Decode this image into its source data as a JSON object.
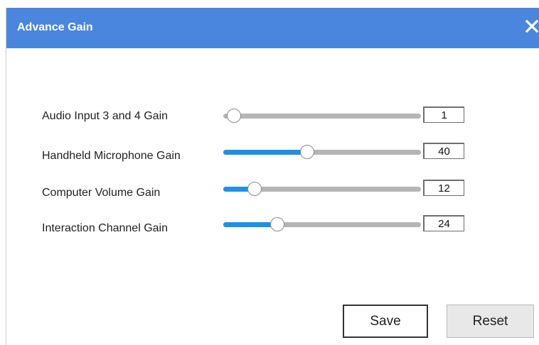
{
  "dialog": {
    "title": "Advance Gain",
    "close_icon": "close-icon"
  },
  "gains": [
    {
      "label": "Audio Input 3 and 4 Gain",
      "value": "1",
      "level": 0.01
    },
    {
      "label": "Handheld Microphone Gain",
      "value": "40",
      "level": 0.4
    },
    {
      "label": "Computer Volume Gain",
      "value": "12",
      "level": 0.12
    },
    {
      "label": "Interaction Channel Gain",
      "value": "24",
      "level": 0.24
    }
  ],
  "buttons": {
    "save_label": "Save",
    "reset_label": "Reset"
  },
  "colors": {
    "titlebar": "#4a86dd",
    "slider_fill": "#1e90e6",
    "slider_track": "#b5b5b5"
  }
}
